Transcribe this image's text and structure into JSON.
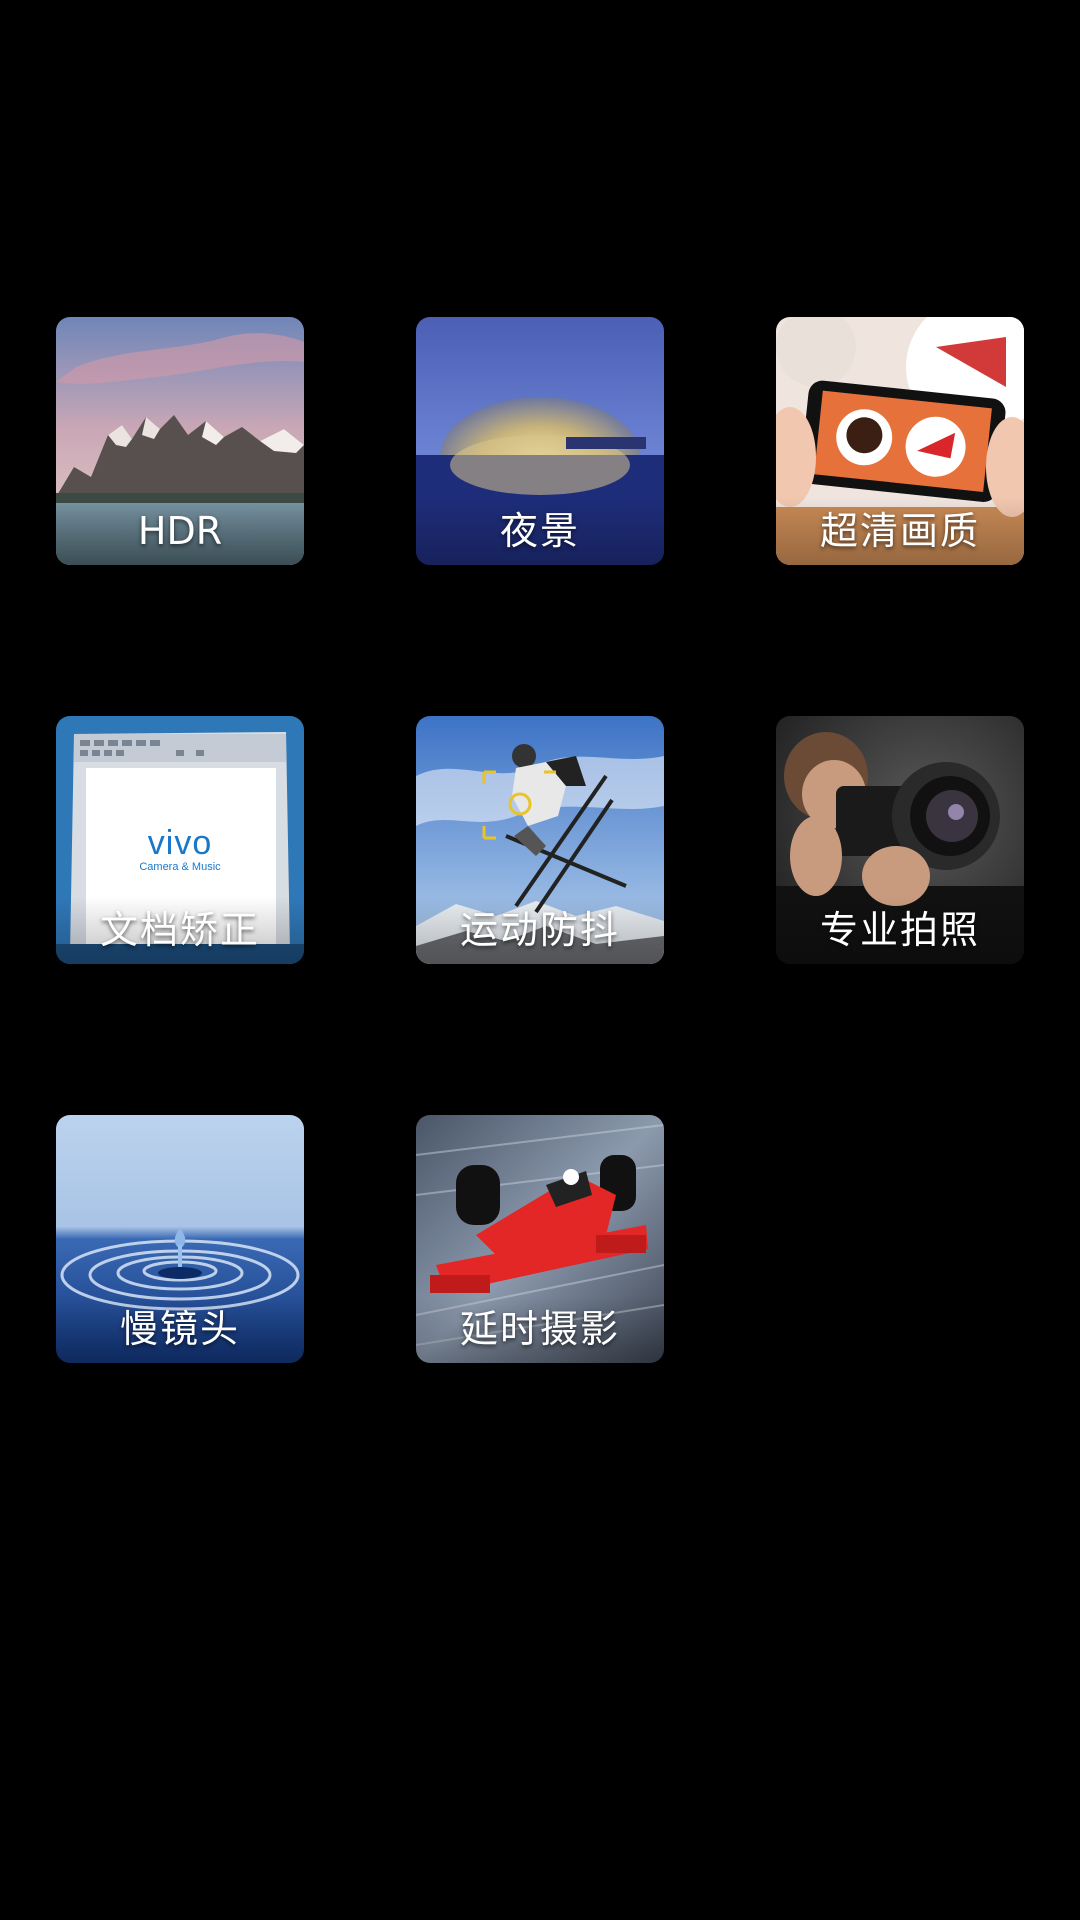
{
  "modes": [
    {
      "label": "HDR",
      "icon": "mountain-lake-icon"
    },
    {
      "label": "夜景",
      "icon": "night-building-icon"
    },
    {
      "label": "超清画质",
      "icon": "phone-photo-icon"
    },
    {
      "label": "文档矫正",
      "icon": "document-icon",
      "doc_brand": "vivo",
      "doc_tagline": "Camera & Music"
    },
    {
      "label": "运动防抖",
      "icon": "skier-icon"
    },
    {
      "label": "专业拍照",
      "icon": "photographer-icon"
    },
    {
      "label": "慢镜头",
      "icon": "water-drop-icon"
    },
    {
      "label": "延时摄影",
      "icon": "race-car-icon"
    }
  ]
}
